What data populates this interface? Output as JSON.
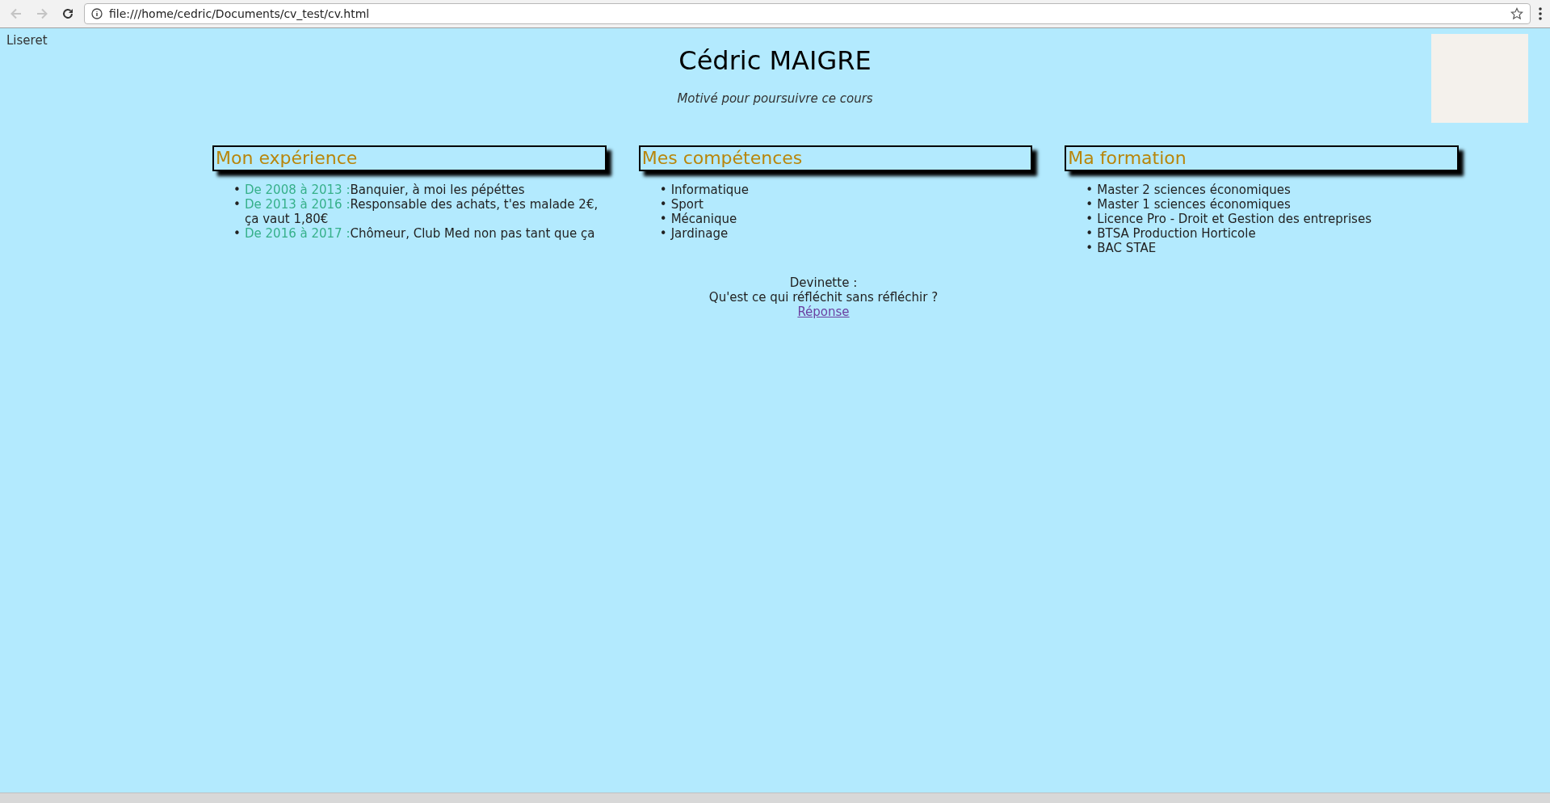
{
  "browser": {
    "back": {
      "disabled": true
    },
    "forward": {
      "disabled": true
    },
    "url": "file:///home/cedric/Documents/cv_test/cv.html"
  },
  "page": {
    "corner_link": "Liseret",
    "name": "Cédric MAIGRE",
    "tagline": "Motivé pour poursuivre ce cours",
    "sections": [
      {
        "title": "Mon expérience",
        "items": [
          {
            "marker": "•",
            "period": "De 2008 à 2013 :",
            "text": "Banquier, à moi les pépéttes"
          },
          {
            "marker": "•",
            "period": "De 2013 à 2016 :",
            "text": "Responsable des achats, t'es malade 2€, ça vaut 1,80€"
          },
          {
            "marker": "•",
            "period": "De 2016 à 2017 :",
            "text": "Chômeur, Club Med non pas tant que ça"
          }
        ]
      },
      {
        "title": "Mes compétences",
        "items": [
          {
            "marker": "•",
            "text": "Informatique"
          },
          {
            "marker": "•",
            "text": "Sport"
          },
          {
            "marker": "•",
            "text": "Mécanique"
          },
          {
            "marker": "•",
            "text": "Jardinage"
          }
        ]
      },
      {
        "title": "Ma formation",
        "items": [
          {
            "marker": "•",
            "text": "Master 2 sciences économiques"
          },
          {
            "marker": "•",
            "text": "Master 1 sciences économiques"
          },
          {
            "marker": "•",
            "text": "Licence Pro - Droit et Gestion des entreprises"
          },
          {
            "marker": "•",
            "text": "BTSA Production Horticole"
          },
          {
            "marker": "•",
            "text": "BAC STAE"
          }
        ]
      }
    ],
    "riddle": {
      "label": "Devinette :",
      "question": "Qu'est ce qui réfléchit sans réfléchir ?",
      "answer_link": "Réponse"
    }
  }
}
